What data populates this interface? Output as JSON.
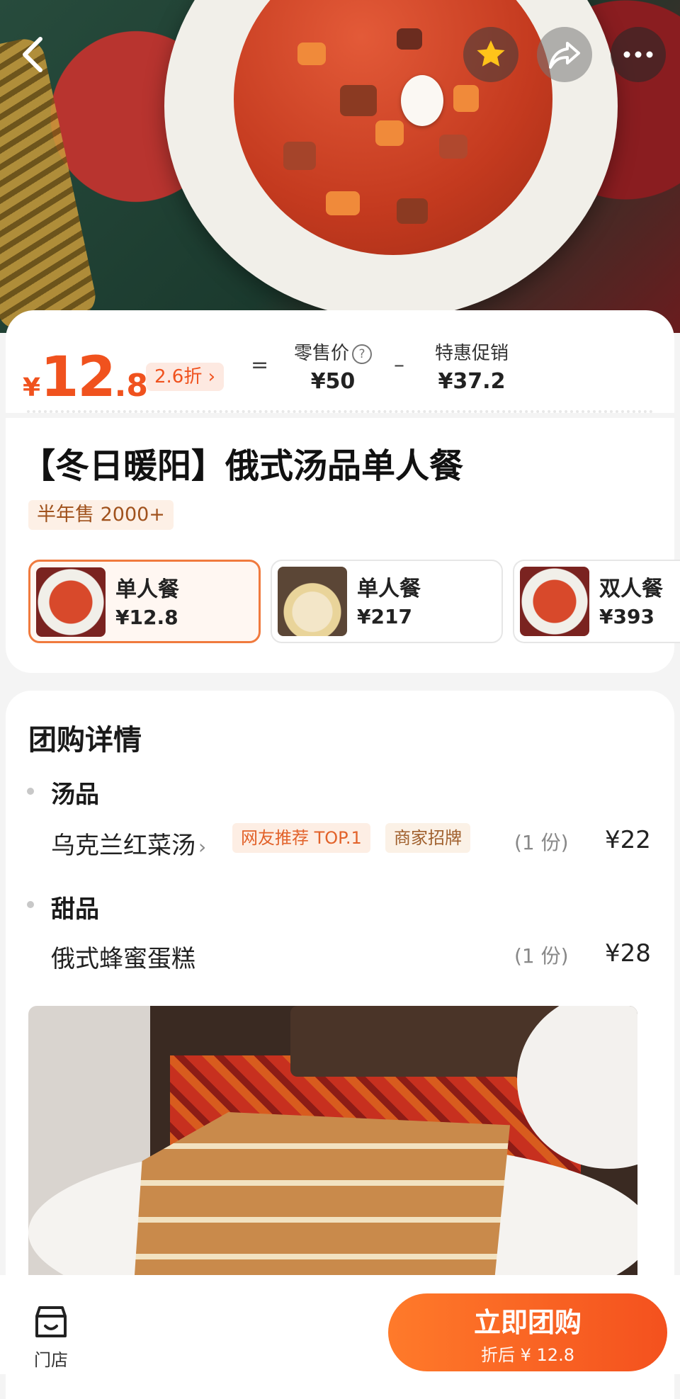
{
  "colors": {
    "accent": "#f0521e",
    "button_gradient_start": "#ff7a2a",
    "button_gradient_end": "#f4511e",
    "selected_border": "#f07a3e"
  },
  "header": {
    "back_icon": "chevron-left-icon",
    "favorite_icon": "star-icon",
    "share_icon": "share-icon",
    "more_icon": "more-dots-icon"
  },
  "price": {
    "currency": "¥",
    "current_int": "12",
    "current_dec": ".8",
    "discount_label": "2.6折",
    "equals": "=",
    "retail_label": "零售价",
    "retail_value": "¥50",
    "minus": "–",
    "promo_label": "特惠促销",
    "promo_value": "¥37.2"
  },
  "deal": {
    "title": "【冬日暖阳】俄式汤品单人餐",
    "sales": "半年售 2000+",
    "options": [
      {
        "name": "单人餐",
        "price": "¥12.8",
        "selected": true
      },
      {
        "name": "单人餐",
        "price": "¥217",
        "selected": false
      },
      {
        "name": "双人餐",
        "price": "¥393",
        "selected": false
      }
    ]
  },
  "details": {
    "title": "团购详情",
    "groups": [
      {
        "category": "汤品",
        "items": [
          {
            "name": "乌克兰红菜汤",
            "tags": [
              "网友推荐 TOP.1",
              "商家招牌"
            ],
            "qty": "(1 份)",
            "price": "¥22"
          }
        ]
      },
      {
        "category": "甜品",
        "items": [
          {
            "name": "俄式蜂蜜蛋糕",
            "tags": [],
            "qty": "(1 份)",
            "price": "¥28"
          }
        ]
      }
    ]
  },
  "bottom": {
    "store_label": "门店",
    "store_icon": "store-icon",
    "buy_label": "立即团购",
    "buy_sub": "折后 ¥ 12.8"
  }
}
